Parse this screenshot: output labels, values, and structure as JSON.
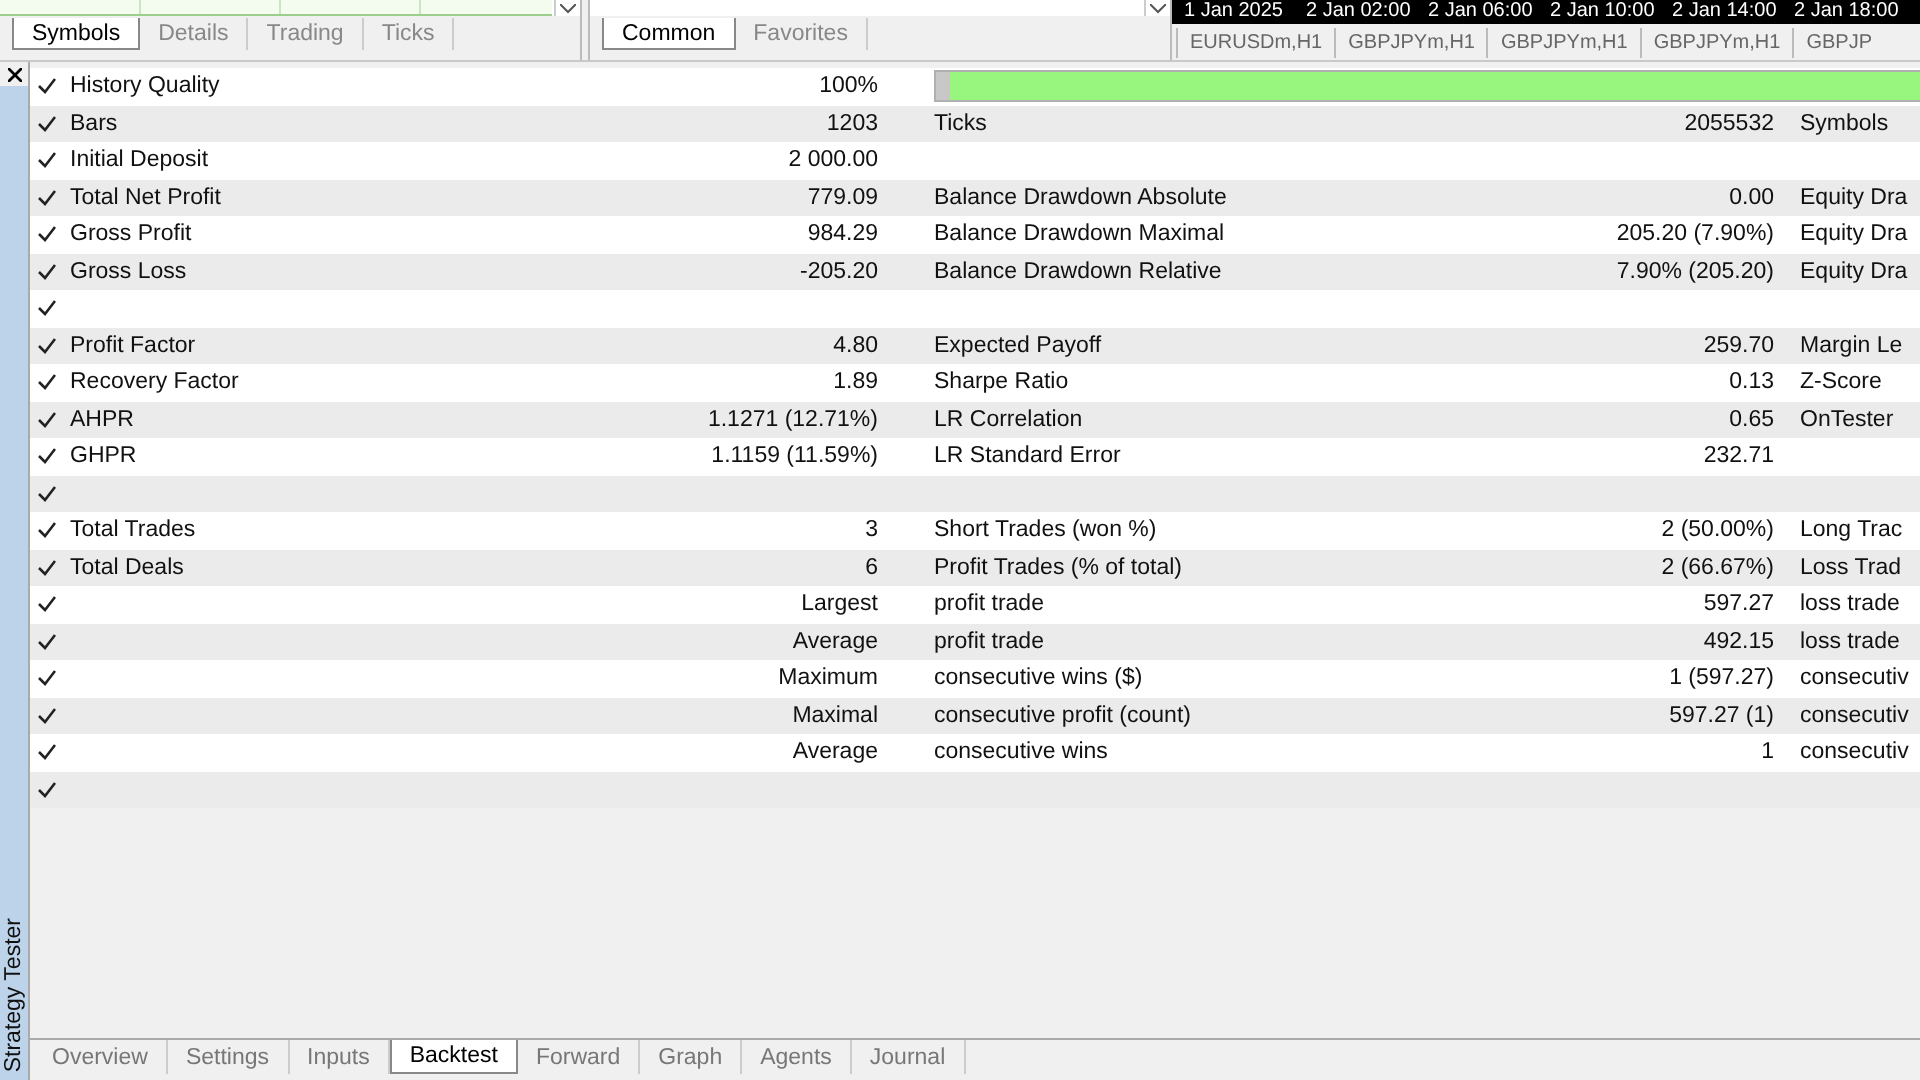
{
  "symbols_panel": {
    "tabs": [
      {
        "label": "Symbols",
        "selected": true
      },
      {
        "label": "Details",
        "selected": false
      },
      {
        "label": "Trading",
        "selected": false
      },
      {
        "label": "Ticks",
        "selected": false
      }
    ]
  },
  "market_panel": {
    "tabs": [
      {
        "label": "Common",
        "selected": true
      },
      {
        "label": "Favorites",
        "selected": false
      }
    ]
  },
  "chart_panel": {
    "time_axis": [
      "1 Jan 2025",
      "2 Jan 02:00",
      "2 Jan 06:00",
      "2 Jan 10:00",
      "2 Jan 14:00",
      "2 Jan 18:00"
    ],
    "chart_tabs": [
      "EURUSDm,H1",
      "GBPJPYm,H1",
      "GBPJPYm,H1",
      "GBPJPYm,H1",
      "GBPJP"
    ]
  },
  "side_panel": {
    "title": "Strategy Tester"
  },
  "report": {
    "rows": [
      {
        "checked": true,
        "label": "History Quality",
        "value": "100%",
        "kind": "quality",
        "level": 1
      },
      {
        "checked": true,
        "label": "Bars",
        "value": "1203",
        "label_2": "Ticks",
        "value_2": "2055532",
        "label_3": "Symbols"
      },
      {
        "checked": true,
        "label": "Initial Deposit",
        "value": "2 000.00"
      },
      {
        "checked": true,
        "label": "Total Net Profit",
        "value": "779.09",
        "label_2": "Balance Drawdown Absolute",
        "value_2": "0.00",
        "label_3": "Equity Dra"
      },
      {
        "checked": true,
        "label": "Gross Profit",
        "value": "984.29",
        "label_2": "Balance Drawdown Maximal",
        "value_2": "205.20 (7.90%)",
        "label_3": "Equity Dra"
      },
      {
        "checked": true,
        "label": "Gross Loss",
        "value": "-205.20",
        "label_2": "Balance Drawdown Relative",
        "value_2": "7.90% (205.20)",
        "label_3": "Equity Dra"
      },
      {
        "checked": true
      },
      {
        "checked": true,
        "label": "Profit Factor",
        "value": "4.80",
        "label_2": "Expected Payoff",
        "value_2": "259.70",
        "label_3": "Margin Le"
      },
      {
        "checked": true,
        "label": "Recovery Factor",
        "value": "1.89",
        "label_2": "Sharpe Ratio",
        "value_2": "0.13",
        "label_3": "Z-Score"
      },
      {
        "checked": true,
        "label": "AHPR",
        "value": "1.1271 (12.71%)",
        "label_2": "LR Correlation",
        "value_2": "0.65",
        "label_3": "OnTester"
      },
      {
        "checked": true,
        "label": "GHPR",
        "value": "1.1159 (11.59%)",
        "label_2": "LR Standard Error",
        "value_2": "232.71"
      },
      {
        "checked": true
      },
      {
        "checked": true,
        "label": "Total Trades",
        "value": "3",
        "label_2": "Short Trades (won %)",
        "value_2": "2 (50.00%)",
        "label_3": "Long Trac"
      },
      {
        "checked": true,
        "label": "Total Deals",
        "value": "6",
        "label_2": "Profit Trades (% of total)",
        "value_2": "2 (66.67%)",
        "label_3": "Loss Trad"
      },
      {
        "checked": true,
        "value": "Largest",
        "label_2": "profit trade",
        "value_2": "597.27",
        "label_3": "loss trade"
      },
      {
        "checked": true,
        "value": "Average",
        "label_2": "profit trade",
        "value_2": "492.15",
        "label_3": "loss trade"
      },
      {
        "checked": true,
        "value": "Maximum",
        "label_2": "consecutive wins ($)",
        "value_2": "1 (597.27)",
        "label_3": "consecutiv"
      },
      {
        "checked": true,
        "value": "Maximal",
        "label_2": "consecutive profit (count)",
        "value_2": "597.27 (1)",
        "label_3": "consecutiv"
      },
      {
        "checked": true,
        "value": "Average",
        "label_2": "consecutive wins",
        "value_2": "1",
        "label_3": "consecutiv"
      },
      {
        "checked": true
      }
    ]
  },
  "bottom_tabs": [
    {
      "label": "Overview",
      "selected": false
    },
    {
      "label": "Settings",
      "selected": false
    },
    {
      "label": "Inputs",
      "selected": false
    },
    {
      "label": "Backtest",
      "selected": true
    },
    {
      "label": "Forward",
      "selected": false
    },
    {
      "label": "Graph",
      "selected": false
    },
    {
      "label": "Agents",
      "selected": false
    },
    {
      "label": "Journal",
      "selected": false
    }
  ]
}
